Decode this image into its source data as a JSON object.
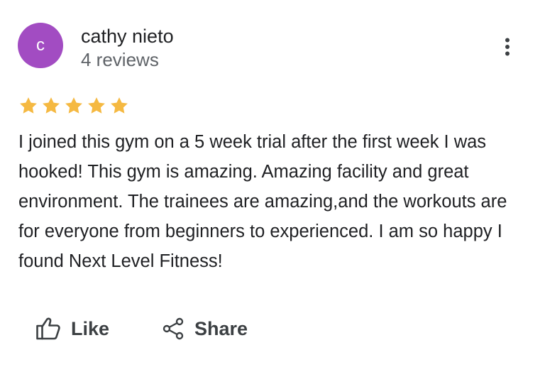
{
  "reviewer": {
    "initial": "c",
    "name": "cathy nieto",
    "review_count": "4 reviews",
    "avatar_color": "#a24cc2"
  },
  "rating": {
    "stars": 5,
    "max": 5,
    "star_color": "#f5b942"
  },
  "review": {
    "text": "I joined this gym on a 5 week trial after the first week I was hooked! This gym is amazing. Amazing facility and great environment. The trainees are amazing,and the workouts are for everyone from beginners to experienced. I am so happy I found Next Level Fitness!"
  },
  "actions": {
    "like_label": "Like",
    "like_icon": "thumbs-up-icon",
    "share_label": "Share",
    "share_icon": "share-icon"
  },
  "menu": {
    "icon": "more-vertical-icon"
  }
}
